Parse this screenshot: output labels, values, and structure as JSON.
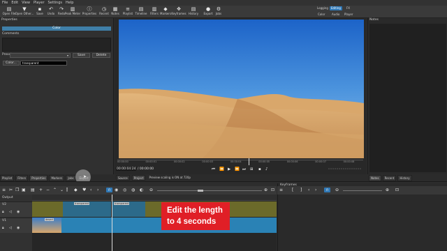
{
  "menu": [
    "File",
    "Edit",
    "View",
    "Player",
    "Settings",
    "Help"
  ],
  "toolbar": [
    {
      "label": "Open File",
      "icon": "open-file-icon",
      "glyph": "▤"
    },
    {
      "label": "Open Other...",
      "icon": "open-other-icon",
      "glyph": "▼"
    },
    {
      "label": "Save",
      "icon": "save-icon",
      "glyph": "▪"
    },
    {
      "label": "Undo",
      "icon": "undo-icon",
      "glyph": "↶"
    },
    {
      "label": "Redo",
      "icon": "redo-icon",
      "glyph": "↷"
    },
    {
      "label": "Peak Meter",
      "icon": "peak-meter-icon",
      "glyph": "▥"
    },
    {
      "label": "Properties",
      "icon": "properties-icon",
      "glyph": "ⓘ"
    },
    {
      "label": "Recent",
      "icon": "recent-icon",
      "glyph": "◷"
    },
    {
      "label": "Notes",
      "icon": "notes-icon",
      "glyph": "▦"
    },
    {
      "label": "Playlist",
      "icon": "playlist-icon",
      "glyph": "≡"
    },
    {
      "label": "Timeline",
      "icon": "timeline-icon",
      "glyph": "▤"
    },
    {
      "label": "Filters",
      "icon": "filters-icon",
      "glyph": "▥"
    },
    {
      "label": "Markers",
      "icon": "markers-icon",
      "glyph": "◆"
    },
    {
      "label": "Keyframes",
      "icon": "keyframes-icon",
      "glyph": "✥"
    },
    {
      "label": "History",
      "icon": "history-icon",
      "glyph": "▤"
    },
    {
      "label": "Export",
      "icon": "export-icon",
      "glyph": "●"
    },
    {
      "label": "Jobs",
      "icon": "jobs-icon",
      "glyph": "⚙"
    }
  ],
  "layouts": {
    "top": [
      "Logging",
      "Editing",
      "FX"
    ],
    "bottom": [
      "Color",
      "Audio",
      "Player"
    ],
    "active": "Editing"
  },
  "properties": {
    "title": "Properties",
    "section": "Color",
    "comments_label": "Comments",
    "preset_label": "Preset",
    "save_label": "Save",
    "delete_label": "Delete",
    "color_button": "Color...",
    "color_value": "transparent"
  },
  "player": {
    "ruler": [
      "00:00:00",
      "00:00:01",
      "00:00:02",
      "00:00:03",
      "00:00:04",
      "00:00:05",
      "00:00:06",
      "00:00:07",
      "00:00:08"
    ],
    "timecode": "00:00:04:24",
    "duration": "/ 00:00:00",
    "tabs": [
      "Source",
      "Project"
    ],
    "scaling_note": "Preview scaling is ON at 720p"
  },
  "notes": {
    "title": "Notes",
    "tabs": [
      "Notes",
      "Recent",
      "History"
    ]
  },
  "left_tabs": [
    "Playlist",
    "Filters",
    "Properties",
    "Markers",
    "Jobs",
    "Export"
  ],
  "timeline": {
    "title": "Timeline",
    "output_label": "Output",
    "tracks": [
      {
        "name": "V2"
      },
      {
        "name": "V1"
      }
    ],
    "clips_v2": [
      {
        "label": "transparent"
      },
      {
        "label": "transparent"
      }
    ],
    "clip_v1_label": "desert"
  },
  "keyframes": {
    "title": "Keyframes"
  },
  "callout": {
    "line1": "Edit the length",
    "line2": "to 4 seconds"
  }
}
